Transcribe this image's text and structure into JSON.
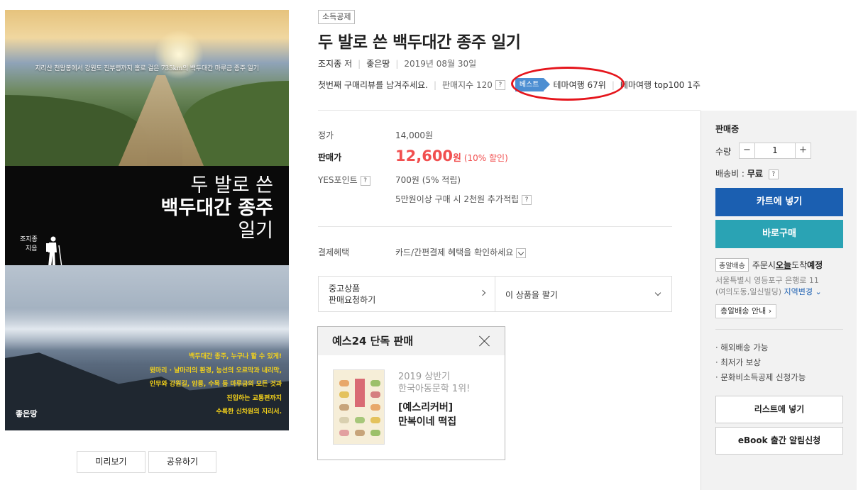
{
  "cover": {
    "subtitle": "지리산 천왕봉에서 강원도 진부령까지 홀로 걸은 735km의 백두대간 마루금 종주 일기",
    "title_line1": "두 발로 쓴",
    "title_line2": "백두대간 종주",
    "title_line3": "일기",
    "author_line1": "조지종",
    "author_line2": "지음",
    "blurb": [
      "백두대간 종주, 누구나 할 수 있게!",
      "윗마리 · 날마리의 환경, 능선의 오르막과 내리막,",
      "인무와 강원길, 암릉, 수목 등 마루금의 모든 것과",
      "진입하는 교통편까지",
      "수록한 신차원의 지리서."
    ],
    "publisher": "좋은땅"
  },
  "buttons": {
    "preview": "미리보기",
    "share": "공유하기"
  },
  "product": {
    "tag": "소득공제",
    "title": "두 발로 쓴 백두대간 종주 일기",
    "author": "조지종",
    "author_role": "저",
    "publisher": "좋은땅",
    "date": "2019년 08월 30일",
    "review_prompt": "첫번째 구매리뷰를 남겨주세요.",
    "sales_index": "판매지수 120",
    "help_mark": "?",
    "best_badge": "베스트",
    "rank1": "테마여행 67위",
    "rank2": "테마여행 top100 1주"
  },
  "price": {
    "list_label": "정가",
    "list_value": "14,000원",
    "sale_label": "판매가",
    "sale_value": "12,600",
    "sale_unit": "원",
    "sale_discount": "(10% 할인)",
    "point_label": "YES포인트",
    "point_value": "700원 (5% 적립)",
    "point_extra": "5만원이상 구매 시 2천원 추가적립",
    "pay_label": "결제혜택",
    "pay_value": "카드/간편결제 혜택을 확인하세요"
  },
  "used": {
    "cell1_line1": "중고상품",
    "cell1_line2": "판매요청하기",
    "cell2": "이 상품을 팔기"
  },
  "exclusive": {
    "header": "예스24 단독 판매",
    "line1": "2019 상반기",
    "line2": "한국아동문학 1위!",
    "title1": "[예스리커버]",
    "title2": "만복이네 떡집"
  },
  "side": {
    "status": "판매중",
    "qty_label": "수량",
    "qty_value": "1",
    "minus": "−",
    "plus": "+",
    "ship_label": "배송비 : ",
    "ship_value": "무료",
    "cart": "카트에 넣기",
    "buy": "바로구매",
    "deliv_tag": "총알배송",
    "deliv_text1": "주문시 ",
    "deliv_today": "오늘",
    "deliv_text2": " 도착 ",
    "deliv_eta": "예정",
    "address1": "서울특별시 영등포구 은행로 11",
    "address2": "(여의도동,일신빌딩)",
    "address_change": "지역변경",
    "deliv_info": "총알배송 안내",
    "features": [
      "· 해외배송 가능",
      "· 최저가 보상",
      "· 문화비소득공제 신청가능"
    ],
    "list_btn": "리스트에 넣기",
    "ebook_btn": "eBook 출간 알림신청"
  },
  "colors": {
    "sale_red": "#f14f4f",
    "cart_blue": "#1b5fb1",
    "buy_teal": "#2aa3b4",
    "best_blue": "#4c8ed2",
    "annotation_red": "#e5151c"
  }
}
